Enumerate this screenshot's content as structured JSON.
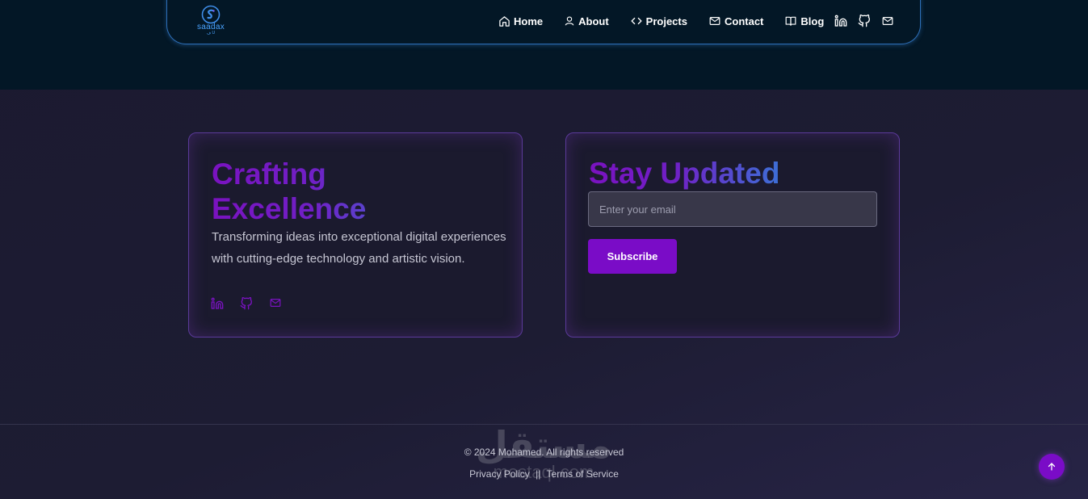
{
  "brand": {
    "logo_text": "saadax",
    "logo_sub": "ف  U"
  },
  "nav": {
    "items": [
      {
        "label": "Home",
        "icon": "home-icon"
      },
      {
        "label": "About",
        "icon": "user-icon"
      },
      {
        "label": "Projects",
        "icon": "code-icon"
      },
      {
        "label": "Contact",
        "icon": "mail-icon"
      },
      {
        "label": "Blog",
        "icon": "book-icon"
      }
    ],
    "social_icons": [
      "linkedin-icon",
      "github-icon",
      "mail-icon"
    ]
  },
  "hero_card": {
    "title_line1": "Crafting",
    "title_line2": "Excellence",
    "description": "Transforming ideas into exceptional digital experiences with cutting-edge technology and artistic vision.",
    "social_icons": [
      "linkedin-icon",
      "github-icon",
      "mail-icon"
    ]
  },
  "newsletter": {
    "title": "Stay Updated",
    "email_placeholder": "Enter your email",
    "email_value": "",
    "subscribe_label": "Subscribe"
  },
  "footer": {
    "copyright": "© 2024 Mohamed. All rights reserved",
    "privacy_label": "Privacy Policy",
    "separator": "||",
    "terms_label": "Terms of Service"
  },
  "watermark": {
    "arabic": "مستقل",
    "latin": "mostaql.com"
  },
  "colors": {
    "accent": "#7a0cc7",
    "nav_border": "#2d6fb8",
    "background_dark": "#031726",
    "background_main": "#1b1a30",
    "gradient_start": "#7a12c0",
    "gradient_end": "#3d6fd6"
  }
}
